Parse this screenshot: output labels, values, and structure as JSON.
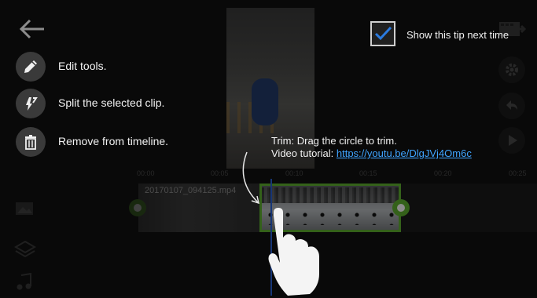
{
  "timeline": {
    "ruler_ticks": [
      "00:00",
      "00:05",
      "00:10",
      "00:15",
      "00:20",
      "00:25"
    ],
    "clip1_label": "20170107_094125.mp4"
  },
  "tips": [
    {
      "label": "Edit tools.",
      "icon": "pencil-icon"
    },
    {
      "label": "Split the selected clip.",
      "icon": "split-icon"
    },
    {
      "label": "Remove from timeline.",
      "icon": "trash-icon"
    }
  ],
  "show_tip": {
    "label": "Show this tip next time",
    "checked": true
  },
  "trim": {
    "line1": "Trim: Drag the circle to trim.",
    "line2_prefix": "Video tutorial: ",
    "link": "https://youtu.be/DlgJVj4Om6c"
  },
  "colors": {
    "accent": "#5fb130",
    "link": "#3fa4ff",
    "playhead": "#2a63d8"
  }
}
